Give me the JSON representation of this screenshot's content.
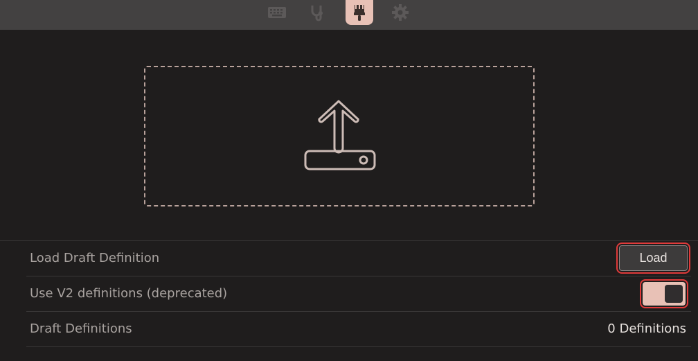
{
  "tabs": [
    {
      "icon": "keyboard-icon",
      "active": false
    },
    {
      "icon": "stethoscope-icon",
      "active": false
    },
    {
      "icon": "brush-icon",
      "active": true
    },
    {
      "icon": "gear-icon",
      "active": false
    }
  ],
  "dropzone": {
    "icon": "upload-icon"
  },
  "settings": {
    "load_draft": {
      "label": "Load Draft Definition",
      "button_label": "Load"
    },
    "use_v2": {
      "label": "Use V2 definitions (deprecated)",
      "toggle_on": true
    },
    "draft_definitions": {
      "label": "Draft Definitions",
      "value": "0 Definitions"
    }
  },
  "colors": {
    "accent": "#e8c1b6",
    "background": "#1f1d1d",
    "topbar": "#434141",
    "highlight": "#e03a3a"
  }
}
